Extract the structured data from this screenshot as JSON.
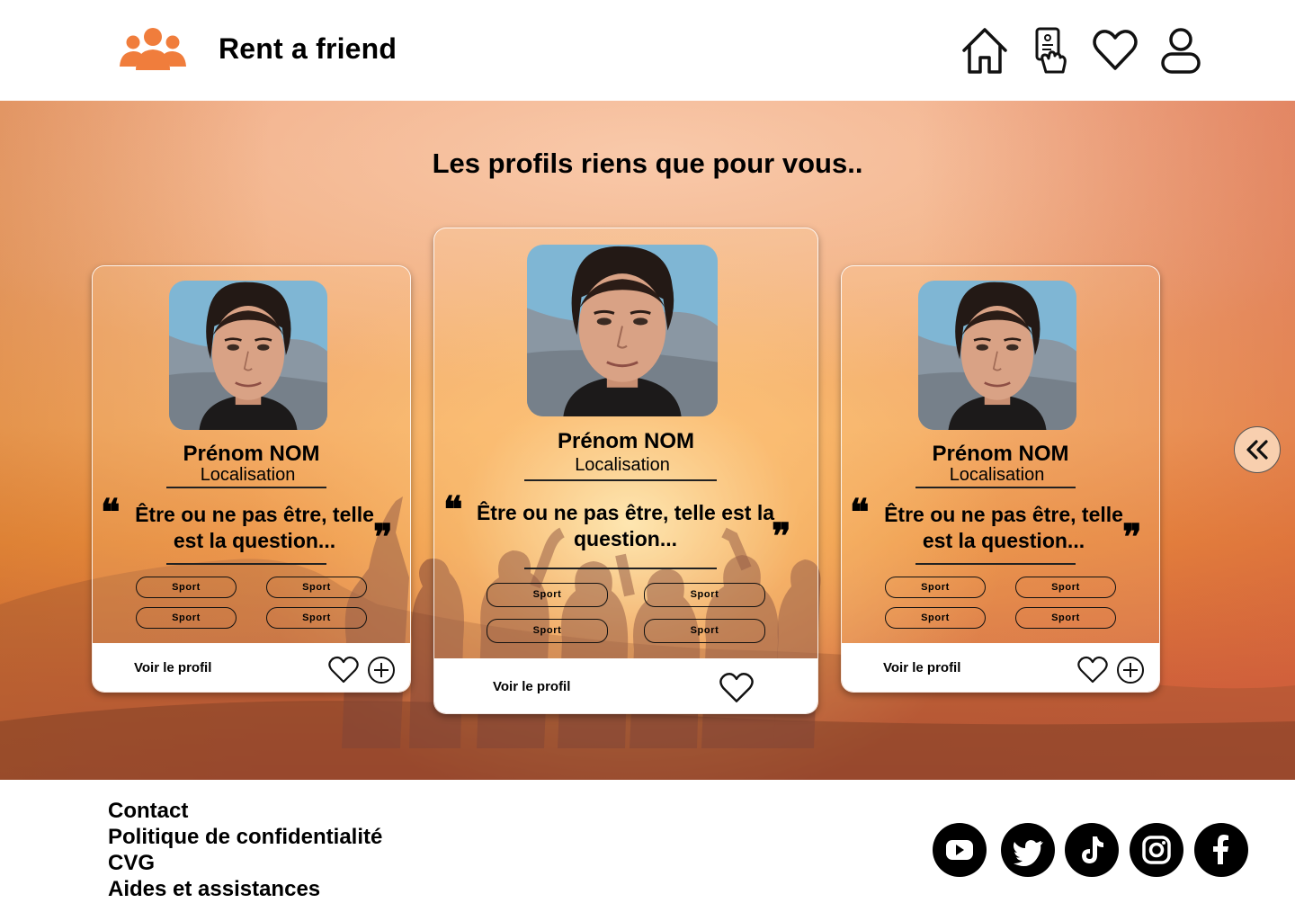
{
  "header": {
    "brand": "Rent a friend",
    "nav": [
      {
        "icon": "home-icon"
      },
      {
        "icon": "phone-tap-icon"
      },
      {
        "icon": "heart-icon"
      },
      {
        "icon": "user-icon"
      }
    ]
  },
  "hero": {
    "title": "Les profils riens que pour vous..",
    "nav_arrow_icon": "double-chevron-left-icon"
  },
  "cards": [
    {
      "name": "Prénom NOM",
      "location": "Localisation",
      "quote_line1": "Être ou ne pas être, telle",
      "quote_line2": "est la question...",
      "tags": [
        "Sport",
        "Sport",
        "Sport",
        "Sport"
      ],
      "cta": "Voir le profil",
      "actions": [
        "heart-icon",
        "plus-circle-icon"
      ]
    },
    {
      "name": "Prénom NOM",
      "location": "Localisation",
      "quote_line1": "Être ou ne pas être, telle est la",
      "quote_line2": "question...",
      "tags": [
        "Sport",
        "Sport",
        "Sport",
        "Sport"
      ],
      "cta": "Voir le profil",
      "actions": [
        "heart-icon"
      ]
    },
    {
      "name": "Prénom NOM",
      "location": "Localisation",
      "quote_line1": "Être ou ne pas être, telle",
      "quote_line2": "est la question...",
      "tags": [
        "Sport",
        "Sport",
        "Sport",
        "Sport"
      ],
      "cta": "Voir le profil",
      "actions": [
        "heart-icon",
        "plus-circle-icon"
      ]
    }
  ],
  "footer": {
    "links": [
      "Contact",
      "Politique de confidentialité",
      "CVG",
      "Aides et assistances"
    ],
    "social": [
      "youtube-icon",
      "twitter-icon",
      "tiktok-icon",
      "instagram-icon",
      "facebook-icon"
    ]
  },
  "colors": {
    "brand_orange": "#f07d3c",
    "hero_top": "#eea47c",
    "hero_bottom": "#c2533a"
  }
}
